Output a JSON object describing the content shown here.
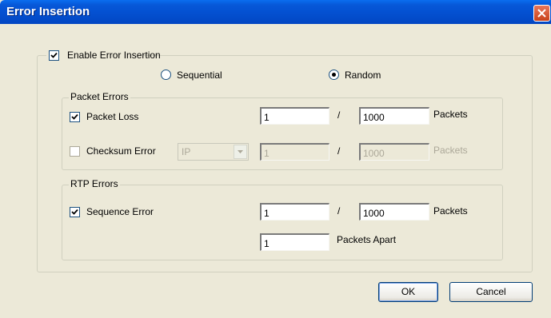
{
  "window": {
    "title": "Error Insertion"
  },
  "enable": {
    "label": "Enable Error Insertion",
    "checked": true
  },
  "mode": {
    "sequential_label": "Sequential",
    "random_label": "Random",
    "selected": "Random"
  },
  "packet_errors": {
    "legend": "Packet Errors",
    "packet_loss": {
      "label": "Packet Loss",
      "checked": true,
      "numerator": "1",
      "separator": "/",
      "denominator": "1000",
      "unit": "Packets"
    },
    "checksum": {
      "label": "Checksum Error",
      "checked": false,
      "protocol": "IP",
      "numerator": "1",
      "separator": "/",
      "denominator": "1000",
      "unit": "Packets"
    }
  },
  "rtp_errors": {
    "legend": "RTP Errors",
    "sequence": {
      "label": "Sequence Error",
      "checked": true,
      "numerator": "1",
      "separator": "/",
      "denominator": "1000",
      "unit": "Packets"
    },
    "apart": {
      "value": "1",
      "label": "Packets Apart"
    }
  },
  "buttons": {
    "ok": "OK",
    "cancel": "Cancel"
  }
}
